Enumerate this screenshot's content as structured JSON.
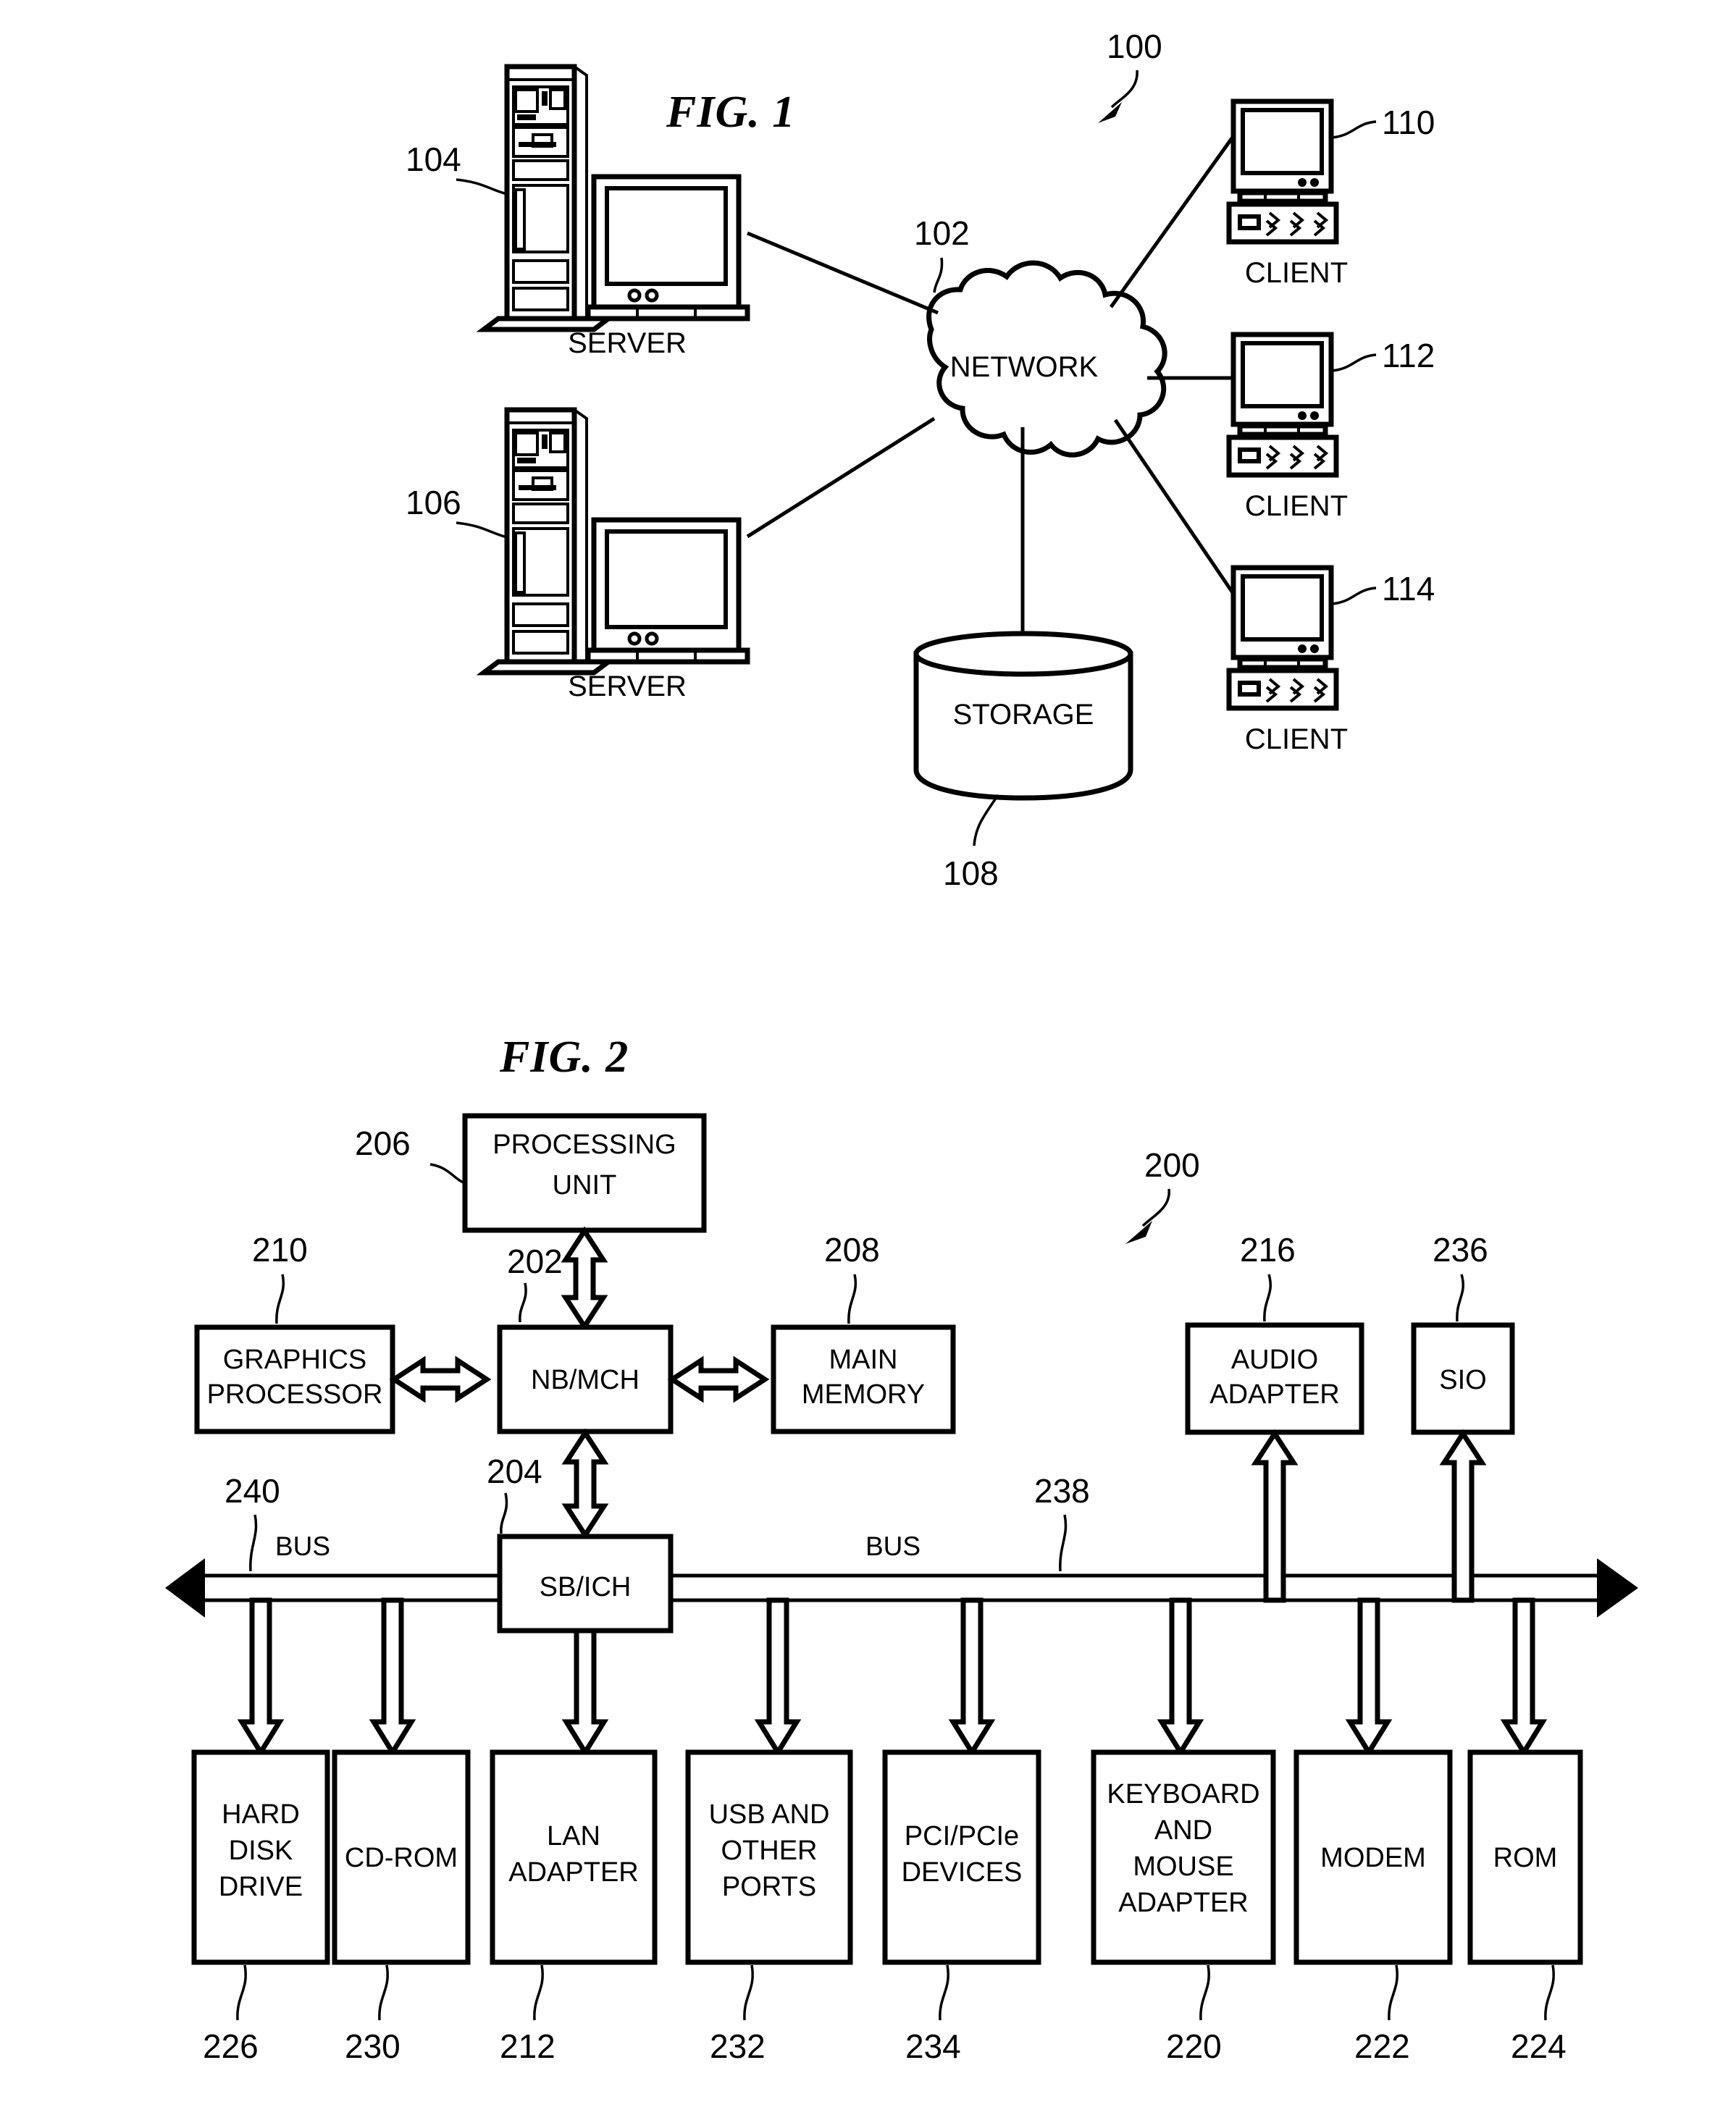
{
  "document": {
    "type": "patent-drawing-sheet",
    "figures": [
      "FIG. 1",
      "FIG. 2"
    ]
  },
  "fig1": {
    "title": "FIG. 1",
    "system_ref": "100",
    "network": {
      "label": "NETWORK",
      "ref": "102"
    },
    "storage": {
      "label": "STORAGE",
      "ref": "108"
    },
    "servers": [
      {
        "label": "SERVER",
        "ref": "104"
      },
      {
        "label": "SERVER",
        "ref": "106"
      }
    ],
    "clients": [
      {
        "label": "CLIENT",
        "ref": "110"
      },
      {
        "label": "CLIENT",
        "ref": "112"
      },
      {
        "label": "CLIENT",
        "ref": "114"
      }
    ]
  },
  "fig2": {
    "title": "FIG. 2",
    "system_ref": "200",
    "processing_unit": {
      "line1": "PROCESSING",
      "line2": "UNIT",
      "ref": "206"
    },
    "nb_mch": {
      "label": "NB/MCH",
      "ref": "202"
    },
    "graphics_processor": {
      "line1": "GRAPHICS",
      "line2": "PROCESSOR",
      "ref": "210"
    },
    "main_memory": {
      "line1": "MAIN",
      "line2": "MEMORY",
      "ref": "208"
    },
    "audio_adapter": {
      "line1": "AUDIO",
      "line2": "ADAPTER",
      "ref": "216"
    },
    "sio": {
      "label": "SIO",
      "ref": "236"
    },
    "sb_ich": {
      "label": "SB/ICH",
      "ref": "204"
    },
    "bus_left": {
      "label": "BUS",
      "ref": "240"
    },
    "bus_right": {
      "label": "BUS",
      "ref": "238"
    },
    "devices": [
      {
        "lines": [
          "HARD",
          "DISK",
          "DRIVE"
        ],
        "ref": "226"
      },
      {
        "lines": [
          "CD-ROM"
        ],
        "ref": "230"
      },
      {
        "lines": [
          "LAN",
          "ADAPTER"
        ],
        "ref": "212"
      },
      {
        "lines": [
          "USB AND",
          "OTHER",
          "PORTS"
        ],
        "ref": "232"
      },
      {
        "lines": [
          "PCI/PCIe",
          "DEVICES"
        ],
        "ref": "234"
      },
      {
        "lines": [
          "KEYBOARD",
          "AND",
          "MOUSE",
          "ADAPTER"
        ],
        "ref": "220"
      },
      {
        "lines": [
          "MODEM"
        ],
        "ref": "222"
      },
      {
        "lines": [
          "ROM"
        ],
        "ref": "224"
      }
    ]
  },
  "colors": {
    "ink": "#000000",
    "paper": "#ffffff"
  }
}
